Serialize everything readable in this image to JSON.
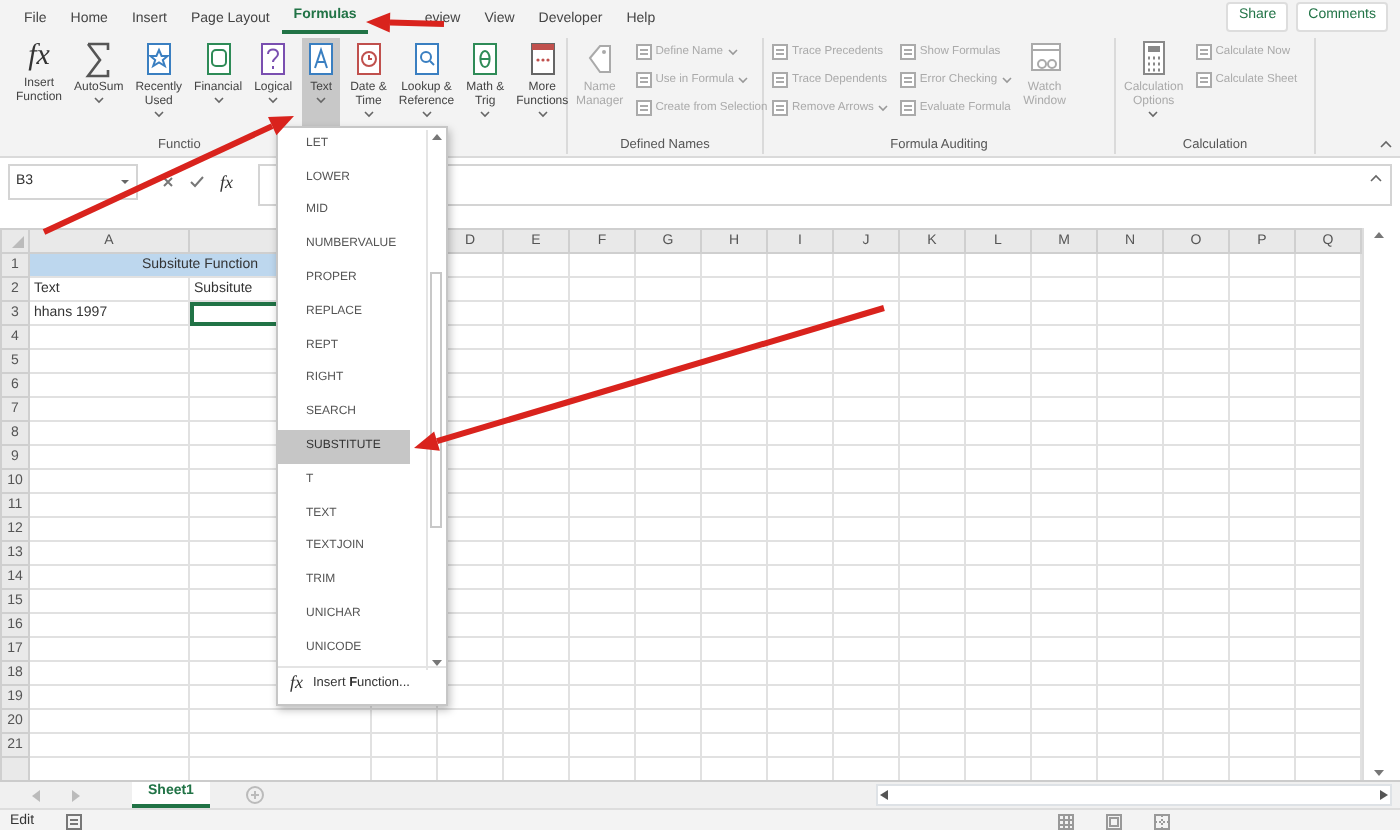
{
  "menu_tabs": [
    {
      "label": "File",
      "selected": false
    },
    {
      "label": "Home",
      "selected": false
    },
    {
      "label": "Insert",
      "selected": false
    },
    {
      "label": "Page Layout",
      "selected": false
    },
    {
      "label": "Formulas",
      "selected": true
    },
    {
      "label": "eview",
      "selected": false
    },
    {
      "label": "View",
      "selected": false
    },
    {
      "label": "Developer",
      "selected": false
    },
    {
      "label": "Help",
      "selected": false
    }
  ],
  "header_buttons": [
    {
      "label": "Share"
    },
    {
      "label": "Comments"
    }
  ],
  "ribbon": {
    "groups": [
      {
        "label": "Functio",
        "items": [
          {
            "kind": "large",
            "lines": [
              "Insert",
              "Function"
            ],
            "glyph": "fx",
            "dropdown": false,
            "disabled": false,
            "selected": false
          },
          {
            "kind": "large",
            "lines": [
              "AutoSum"
            ],
            "dropdown": true,
            "disabled": false,
            "selected": false
          },
          {
            "kind": "large",
            "lines": [
              "Recently",
              "Used"
            ],
            "dropdown": true,
            "disabled": false,
            "selected": false
          },
          {
            "kind": "large",
            "lines": [
              "Financial"
            ],
            "dropdown": true,
            "disabled": false,
            "selected": false
          },
          {
            "kind": "large",
            "lines": [
              "Logical"
            ],
            "dropdown": true,
            "disabled": false,
            "selected": false
          },
          {
            "kind": "large",
            "lines": [
              "Text"
            ],
            "dropdown": true,
            "disabled": false,
            "selected": true
          },
          {
            "kind": "large",
            "lines": [
              "Date &",
              "Time"
            ],
            "dropdown": true,
            "disabled": false,
            "selected": false
          },
          {
            "kind": "large",
            "lines": [
              "Lookup &",
              "Reference"
            ],
            "dropdown": true,
            "disabled": false,
            "selected": false
          },
          {
            "kind": "large",
            "lines": [
              "Math &",
              "Trig"
            ],
            "dropdown": true,
            "disabled": false,
            "selected": false
          },
          {
            "kind": "large",
            "lines": [
              "More",
              "Functions"
            ],
            "dropdown": true,
            "disabled": false,
            "selected": false
          }
        ]
      },
      {
        "label": "Defined Names",
        "items": [
          {
            "kind": "large",
            "lines": [
              "Name",
              "Manager"
            ],
            "dropdown": false,
            "disabled": true,
            "selected": false
          },
          {
            "kind": "small",
            "lines": [
              "Define Name"
            ],
            "dropdown": true,
            "disabled": true,
            "selected": false
          },
          {
            "kind": "small",
            "lines": [
              "Use in Formula"
            ],
            "dropdown": true,
            "disabled": true,
            "selected": false
          },
          {
            "kind": "small",
            "lines": [
              "Create from Selection"
            ],
            "dropdown": false,
            "disabled": true,
            "selected": false
          }
        ]
      },
      {
        "label": "Formula Auditing",
        "items": [
          {
            "kind": "small",
            "lines": [
              "Trace Precedents"
            ],
            "dropdown": false,
            "disabled": true,
            "selected": false
          },
          {
            "kind": "small",
            "lines": [
              "Trace Dependents"
            ],
            "dropdown": false,
            "disabled": true,
            "selected": false
          },
          {
            "kind": "small",
            "lines": [
              "Remove Arrows"
            ],
            "dropdown": true,
            "disabled": true,
            "selected": false
          },
          {
            "kind": "small",
            "lines": [
              "Show Formulas"
            ],
            "dropdown": false,
            "disabled": true,
            "selected": false
          },
          {
            "kind": "small",
            "lines": [
              "Error Checking"
            ],
            "dropdown": true,
            "disabled": true,
            "selected": false
          },
          {
            "kind": "small",
            "lines": [
              "Evaluate Formula"
            ],
            "dropdown": false,
            "disabled": true,
            "selected": false
          },
          {
            "kind": "large",
            "lines": [
              "Watch",
              "Window"
            ],
            "dropdown": false,
            "disabled": true,
            "selected": false
          }
        ]
      },
      {
        "label": "Calculation",
        "items": [
          {
            "kind": "large",
            "lines": [
              "Calculation",
              "Options"
            ],
            "dropdown": true,
            "disabled": true,
            "selected": false
          },
          {
            "kind": "small",
            "lines": [
              "Calculate Now"
            ],
            "dropdown": false,
            "disabled": true,
            "selected": false
          },
          {
            "kind": "small",
            "lines": [
              "Calculate Sheet"
            ],
            "dropdown": false,
            "disabled": true,
            "selected": false
          }
        ]
      }
    ]
  },
  "formula_bar": {
    "name_box": "B3",
    "fx_glyph": "fx"
  },
  "sheet": {
    "columns": [
      {
        "label": "A"
      },
      {},
      {},
      {
        "label": "D"
      },
      {
        "label": "E"
      },
      {
        "label": "F"
      },
      {
        "label": "G"
      },
      {
        "label": "H"
      },
      {
        "label": "I"
      },
      {
        "label": "J"
      },
      {
        "label": "K"
      },
      {
        "label": "L"
      },
      {
        "label": "M"
      },
      {
        "label": "N"
      },
      {
        "label": "O"
      },
      {
        "label": "P"
      },
      {
        "label": "Q"
      }
    ],
    "rows": [
      {
        "header": "1",
        "cells": [
          {
            "kind": "title",
            "text": "Subsitute Function",
            "selected": false
          }
        ]
      },
      {
        "header": "2",
        "cells": [
          {
            "kind": "plain",
            "text": "Text",
            "selected": false
          },
          {
            "kind": "plain",
            "text": "Subsitute",
            "selected": false
          }
        ]
      },
      {
        "header": "3",
        "cells": [
          {
            "kind": "plain",
            "text": "hhans 1997",
            "selected": false
          },
          {
            "kind": "plain",
            "selected": true
          }
        ]
      },
      {
        "header": "4"
      },
      {
        "header": "5"
      },
      {
        "header": "6"
      },
      {
        "header": "7"
      },
      {
        "header": "8"
      },
      {
        "header": "9"
      },
      {
        "header": "10"
      },
      {
        "header": "11"
      },
      {
        "header": "12"
      },
      {
        "header": "13"
      },
      {
        "header": "14"
      },
      {
        "header": "15"
      },
      {
        "header": "16"
      },
      {
        "header": "17"
      },
      {
        "header": "18"
      },
      {
        "header": "19"
      },
      {
        "header": "20"
      },
      {
        "header": "21"
      }
    ]
  },
  "text_menu": {
    "items": [
      {
        "label": "LET",
        "selected": false
      },
      {
        "label": "LOWER",
        "selected": false
      },
      {
        "label": "MID",
        "selected": false
      },
      {
        "label": "NUMBERVALUE",
        "selected": false
      },
      {
        "label": "PROPER",
        "selected": false
      },
      {
        "label": "REPLACE",
        "selected": false
      },
      {
        "label": "REPT",
        "selected": false
      },
      {
        "label": "RIGHT",
        "selected": false
      },
      {
        "label": "SEARCH",
        "selected": false
      },
      {
        "label": "SUBSTITUTE",
        "selected": true
      },
      {
        "label": "T",
        "selected": false
      },
      {
        "label": "TEXT",
        "selected": false
      },
      {
        "label": "TEXTJOIN",
        "selected": false
      },
      {
        "label": "TRIM",
        "selected": false
      },
      {
        "label": "UNICHAR",
        "selected": false
      },
      {
        "label": "UNICODE",
        "selected": false
      }
    ],
    "footer": {
      "glyph": "fx",
      "label": "Insert **F**unction..."
    }
  },
  "sheet_tabs": [
    {
      "label": "Sheet1",
      "selected": true
    }
  ],
  "status_bar": {
    "mode": "Edit"
  }
}
